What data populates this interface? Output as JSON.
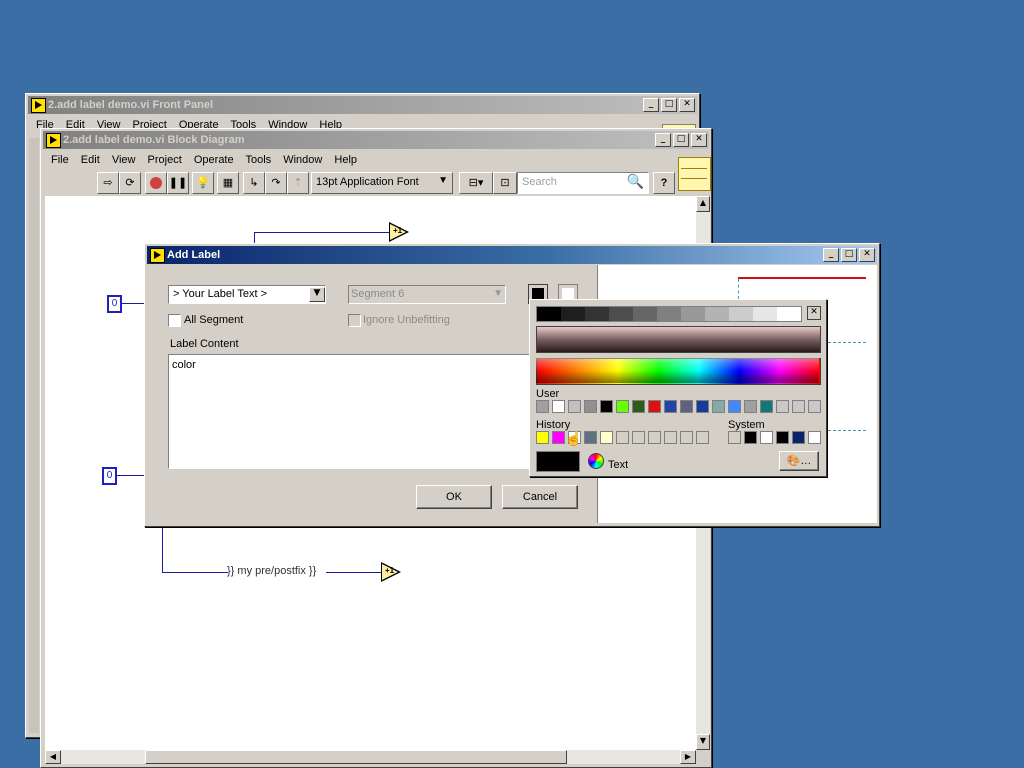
{
  "front_panel": {
    "title": "2.add label demo.vi Front Panel",
    "menu": [
      "File",
      "Edit",
      "View",
      "Project",
      "Operate",
      "Tools",
      "Window",
      "Help"
    ]
  },
  "block_diagram": {
    "title": "2.add label demo.vi Block Diagram",
    "menu": [
      "File",
      "Edit",
      "View",
      "Project",
      "Operate",
      "Tools",
      "Window",
      "Help"
    ],
    "font_select": "13pt Application Font",
    "search_placeholder": "Search",
    "const_top": "0",
    "const_bottom": "0",
    "string_constant": "}} my pre/postfix }}",
    "inc_glyph": "+1"
  },
  "dialog": {
    "title": "Add Label",
    "label_select": "> Your Label Text >",
    "segment_select": "Segment 6",
    "all_segment_label": "All Segment",
    "ignore_label": "Ignore Unbefitting",
    "content_heading": "Label Content",
    "content_value": "color",
    "ok_label": "OK",
    "cancel_label": "Cancel"
  },
  "color_picker": {
    "user_label": "User",
    "history_label": "History",
    "system_label": "System",
    "text_label": "Text",
    "grays": [
      "#000000",
      "#1e1e1e",
      "#333333",
      "#4d4d4d",
      "#666666",
      "#808080",
      "#999999",
      "#b3b3b3",
      "#cccccc",
      "#e6e6e6",
      "#ffffff"
    ],
    "user_colors": [
      "#a0a0a0",
      "#ffffff",
      "#c0c0c0",
      "#909090",
      "#000000",
      "#66ff00",
      "#2e5a1c",
      "#dd1111",
      "#2244aa",
      "#606080",
      "#1a3a99",
      "#88a8a8",
      "#4488ff",
      "#a0a0a0",
      "#117777",
      "#c8c8c8",
      "#c8c8c8",
      "#c8c8c8"
    ],
    "history_colors": [
      "#ffff00",
      "#ff00ff",
      "#ffffff",
      "#607080",
      "#ffffcc",
      "#d4d0c8",
      "#d4d0c8",
      "#d4d0c8",
      "#d4d0c8",
      "#d4d0c8",
      "#d4d0c8"
    ],
    "system_colors": [
      "#d4d0c8",
      "#000000",
      "#ffffff",
      "#000000",
      "#0a246a",
      "#ffffff"
    ],
    "current_color": "#000000"
  }
}
